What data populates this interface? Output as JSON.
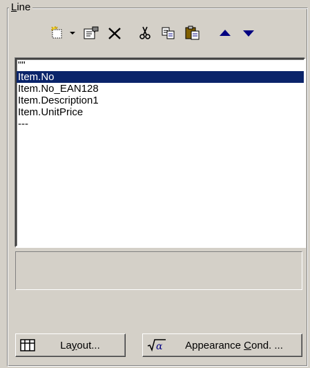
{
  "group": {
    "label": "Line",
    "accel": "L"
  },
  "toolbar": {
    "icons": [
      "new-item-icon",
      "dropdown-arrow-icon",
      "properties-icon",
      "delete-icon",
      "cut-icon",
      "copy-icon",
      "paste-icon",
      "move-up-icon",
      "move-down-icon"
    ]
  },
  "list": {
    "items": [
      "\"\"",
      "Item.No",
      "Item.No_EAN128",
      "Item.Description1",
      "Item.UnitPrice",
      "---"
    ],
    "selected_index": 1
  },
  "buttons": {
    "layout_label": "Layout...",
    "layout_accel": "y",
    "appearance_label": "Appearance Cond. ...",
    "appearance_accel": "C"
  },
  "colors": {
    "face": "#d4d0c8",
    "selection": "#0a246a",
    "arrow": "#000080"
  }
}
